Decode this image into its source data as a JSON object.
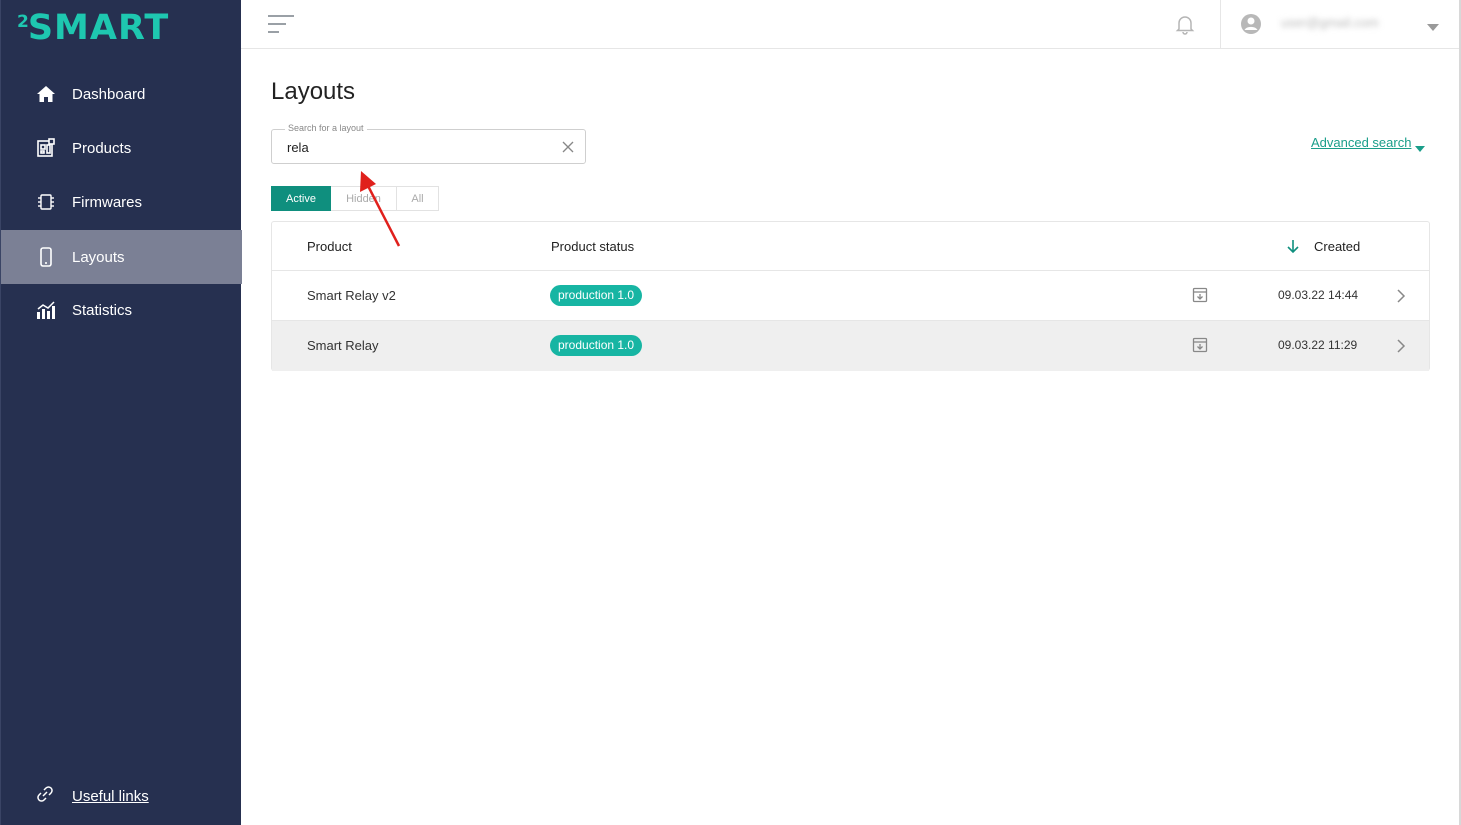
{
  "sidebar": {
    "logo_sup": "2",
    "logo_word": "SMART",
    "items": [
      {
        "label": "Dashboard",
        "icon": "home-icon"
      },
      {
        "label": "Products",
        "icon": "products-icon"
      },
      {
        "label": "Firmwares",
        "icon": "chip-icon"
      },
      {
        "label": "Layouts",
        "icon": "phone-icon",
        "active": true
      },
      {
        "label": "Statistics",
        "icon": "stats-icon"
      }
    ],
    "footer_link": "Useful links"
  },
  "header": {
    "user_email": "user@gmail.com"
  },
  "page": {
    "title": "Layouts",
    "search": {
      "legend": "Search for a layout",
      "value": "rela"
    },
    "advanced_search": "Advanced search",
    "tabs": [
      {
        "label": "Active",
        "active": true
      },
      {
        "label": "Hidden",
        "active": false
      },
      {
        "label": "All",
        "active": false
      }
    ],
    "table": {
      "columns": {
        "product": "Product",
        "status": "Product status",
        "created": "Created"
      },
      "rows": [
        {
          "product": "Smart Relay v2",
          "status": "production 1.0",
          "created": "09.03.22 14:44"
        },
        {
          "product": "Smart Relay",
          "status": "production 1.0",
          "created": "09.03.22 11:29"
        }
      ]
    }
  },
  "colors": {
    "sidebar_bg": "#263050",
    "accent": "#0f8f7e",
    "badge": "#17b5a3",
    "logo": "#1ec7b0",
    "annotation_arrow": "#e0201c"
  }
}
